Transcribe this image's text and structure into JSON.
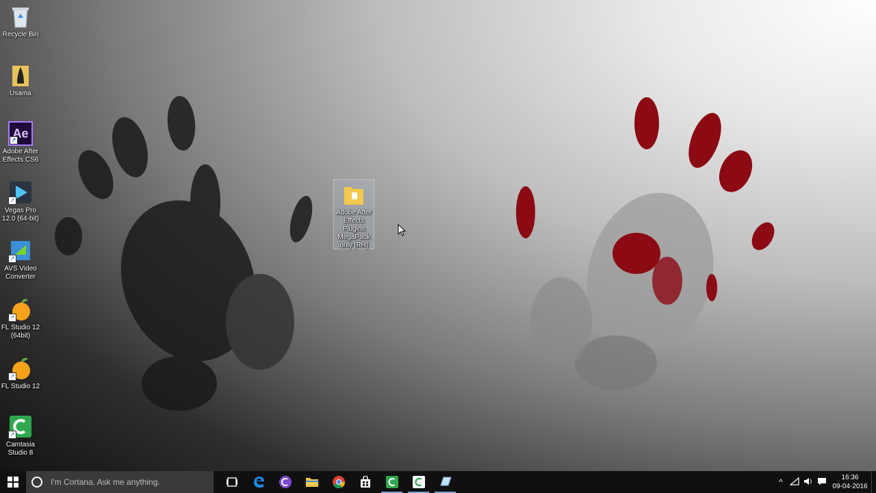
{
  "desktop": {
    "icons": [
      {
        "label": "Recycle Bin",
        "icon": "recycle-bin-icon"
      },
      {
        "label": "Usama",
        "icon": "user-folder-icon"
      },
      {
        "label": "Adobe After Effects CS6",
        "icon": "after-effects-icon"
      },
      {
        "label": "Vegas Pro 12.0 (64-bit)",
        "icon": "vegas-pro-icon"
      },
      {
        "label": "AVS Video Converter",
        "icon": "avs-video-converter-icon"
      },
      {
        "label": "FL Studio 12 (64bit)",
        "icon": "fl-studio-icon"
      },
      {
        "label": "FL Studio 12",
        "icon": "fl-studio-icon"
      },
      {
        "label": "Camtasia Studio 8",
        "icon": "camtasia-icon"
      }
    ],
    "selected_folder": {
      "label": "Adobe After Effects Plugins MegaPack only [RH]",
      "icon": "folder-icon"
    },
    "ae_glyph": "Ae"
  },
  "taskbar": {
    "search_placeholder": "I'm Cortana. Ask me anything.",
    "apps": [
      {
        "name": "task-view",
        "icon": "task-view-icon"
      },
      {
        "name": "edge",
        "icon": "edge-icon"
      },
      {
        "name": "bittorrent",
        "icon": "torrent-icon"
      },
      {
        "name": "file-explorer",
        "icon": "folder-icon"
      },
      {
        "name": "chrome",
        "icon": "chrome-icon"
      },
      {
        "name": "store",
        "icon": "store-icon"
      },
      {
        "name": "camtasia-studio",
        "icon": "camtasia-icon"
      },
      {
        "name": "camtasia-recorder",
        "icon": "camtasia-recorder-icon"
      },
      {
        "name": "notes",
        "icon": "notes-icon"
      }
    ],
    "clock_time": "16:36",
    "clock_date": "09-04-2016"
  },
  "colors": {
    "taskbar_bg": "#101010",
    "search_bg": "#3a3a3a",
    "accent": "#7aa7e0",
    "blood": "#8b0a14"
  }
}
